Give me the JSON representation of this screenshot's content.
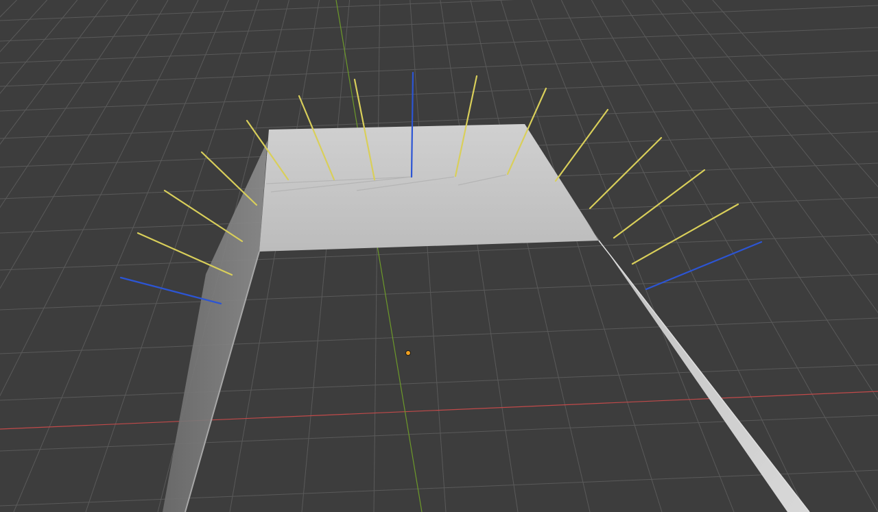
{
  "viewport": {
    "background": "#3d3d3d",
    "grid_color": "#5a5a5a",
    "x_axis_color": "#c24a4a",
    "y_axis_color": "#6d9a2a",
    "mesh_color": "#c9c9c9",
    "normal_color": "#d9cf5a",
    "selected_normal_color": "#2c55d4",
    "origin_color": "#f0a020"
  }
}
